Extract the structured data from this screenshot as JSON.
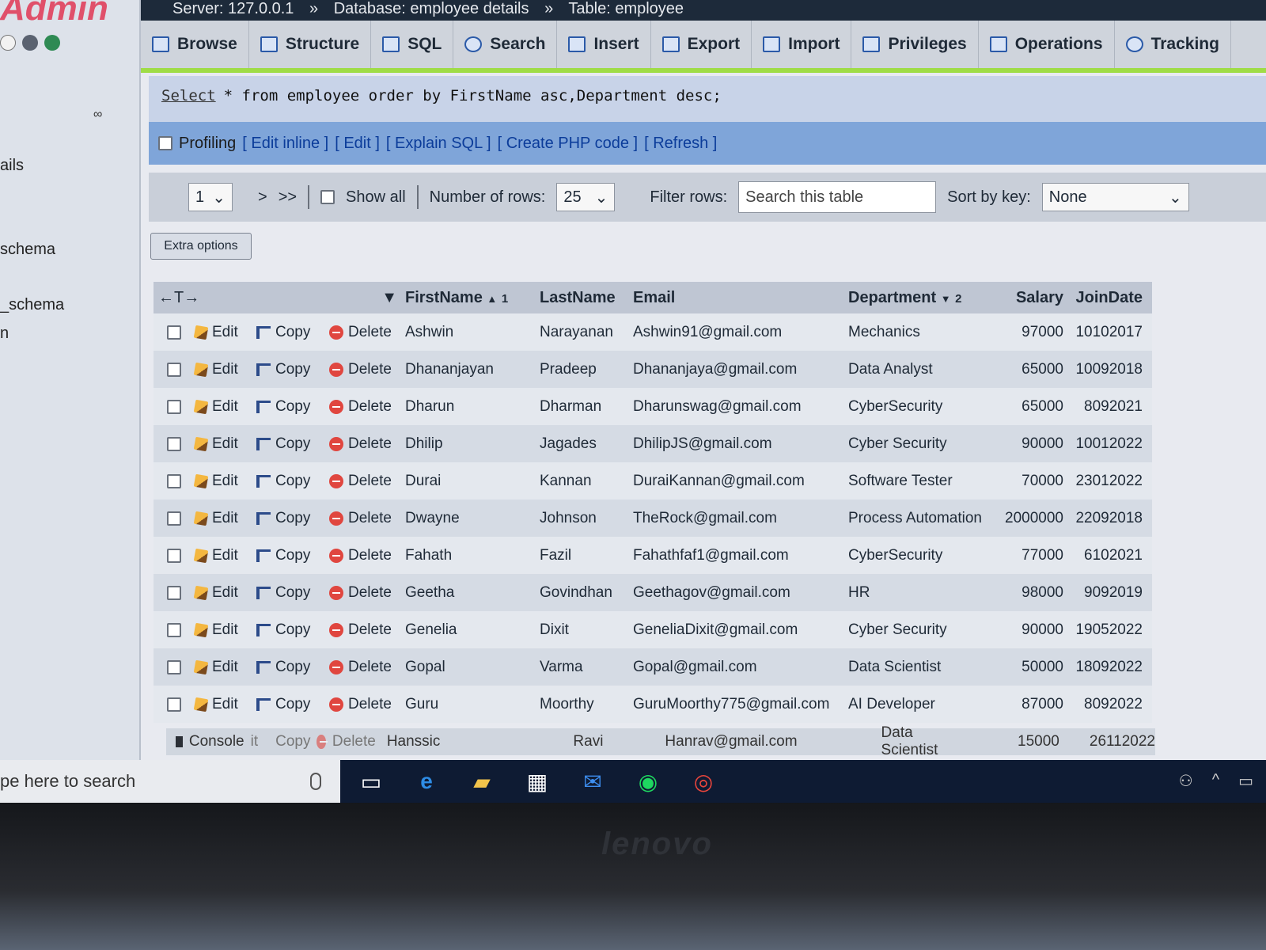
{
  "leftnav": {
    "brand": "Admin",
    "items": [
      "ails",
      "schema",
      "_schema",
      "n"
    ]
  },
  "breadcrumb": {
    "server": "Server: 127.0.0.1",
    "database": "Database: employee details",
    "table": "Table: employee",
    "sep": "»"
  },
  "tabs": [
    "Browse",
    "Structure",
    "SQL",
    "Search",
    "Insert",
    "Export",
    "Import",
    "Privileges",
    "Operations",
    "Tracking"
  ],
  "sql": {
    "keyword": "Select",
    "rest": "* from employee order by FirstName asc,Department desc;",
    "profiling": "Profiling",
    "links": [
      "[ Edit inline ]",
      "[ Edit ]",
      "[ Explain SQL ]",
      "[ Create PHP code ]",
      "[ Refresh ]"
    ]
  },
  "nav": {
    "page": "1",
    "next": ">",
    "last": ">>",
    "show_all": "Show all",
    "rows_label": "Number of rows:",
    "rows_value": "25",
    "filter_label": "Filter rows:",
    "filter_placeholder": "Search this table",
    "sort_label": "Sort by key:",
    "sort_value": "None"
  },
  "extra_options": "Extra options",
  "table": {
    "arrows": "←T→",
    "headers": [
      "FirstName",
      "LastName",
      "Email",
      "Department",
      "Salary",
      "JoinDate"
    ],
    "firstname_sort": "1",
    "department_sort": "2",
    "actions": {
      "edit": "Edit",
      "copy": "Copy",
      "delete": "Delete"
    },
    "rows": [
      [
        "Ashwin",
        "Narayanan",
        "Ashwin91@gmail.com",
        "Mechanics",
        "97000",
        "10102017"
      ],
      [
        "Dhananjayan",
        "Pradeep",
        "Dhananjaya@gmail.com",
        "Data Analyst",
        "65000",
        "10092018"
      ],
      [
        "Dharun",
        "Dharman",
        "Dharunswag@gmail.com",
        "CyberSecurity",
        "65000",
        "8092021"
      ],
      [
        "Dhilip",
        "Jagades",
        "DhilipJS@gmail.com",
        "Cyber Security",
        "90000",
        "10012022"
      ],
      [
        "Durai",
        "Kannan",
        "DuraiKannan@gmail.com",
        "Software Tester",
        "70000",
        "23012022"
      ],
      [
        "Dwayne",
        "Johnson",
        "TheRock@gmail.com",
        "Process Automation",
        "2000000",
        "22092018"
      ],
      [
        "Fahath",
        "Fazil",
        "Fahathfaf1@gmail.com",
        "CyberSecurity",
        "77000",
        "6102021"
      ],
      [
        "Geetha",
        "Govindhan",
        "Geethagov@gmail.com",
        "HR",
        "98000",
        "9092019"
      ],
      [
        "Genelia",
        "Dixit",
        "GeneliaDixit@gmail.com",
        "Cyber Security",
        "90000",
        "19052022"
      ],
      [
        "Gopal",
        "Varma",
        "Gopal@gmail.com",
        "Data Scientist",
        "50000",
        "18092022"
      ],
      [
        "Guru",
        "Moorthy",
        "GuruMoorthy775@gmail.com",
        "AI Developer",
        "87000",
        "8092022"
      ]
    ],
    "partial_row": [
      "Hanssic",
      "Ravi",
      "Hanrav@gmail.com",
      "Data Scientist",
      "15000",
      "26112022"
    ]
  },
  "console": {
    "label": "Console",
    "edit_fragment": "it",
    "copy": "Copy",
    "delete": "Delete"
  },
  "taskbar": {
    "search_placeholder": "pe here to search"
  },
  "laptop_brand": "lenovo"
}
